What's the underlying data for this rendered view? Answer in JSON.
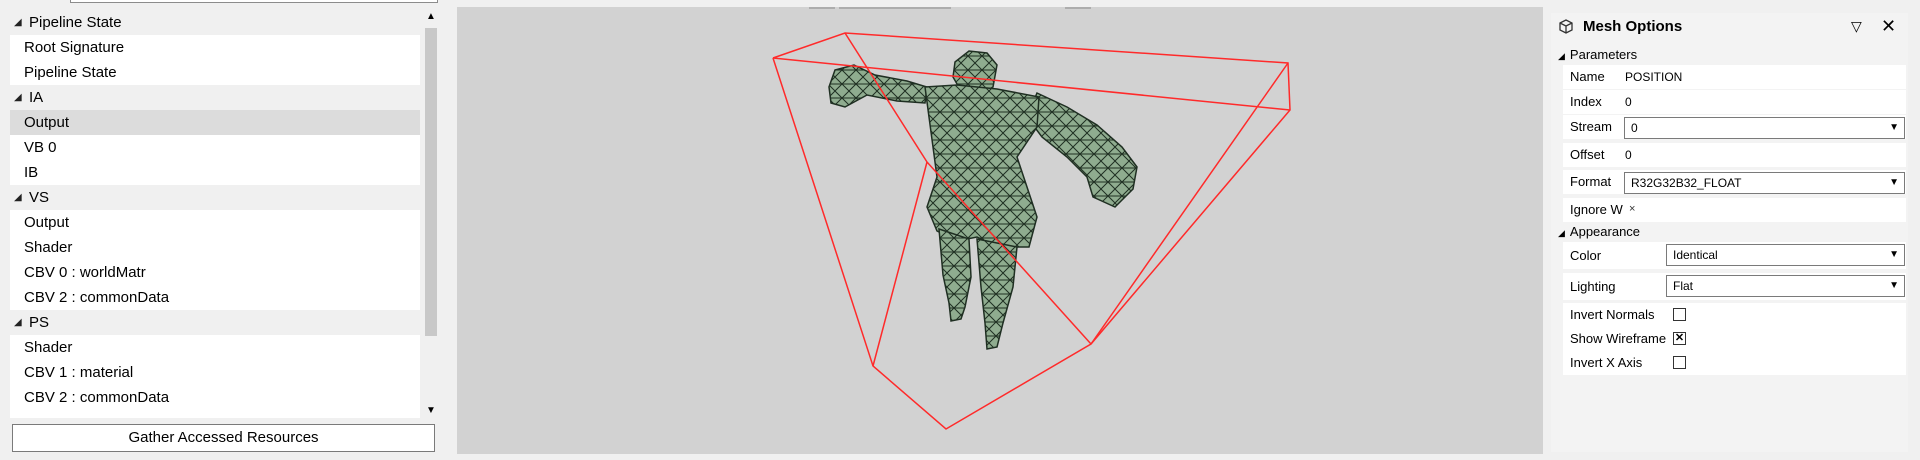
{
  "tree": {
    "groups": [
      {
        "label": "Pipeline State",
        "items": [
          "Root Signature",
          "Pipeline State"
        ]
      },
      {
        "label": "IA",
        "items": [
          "Output",
          "VB 0",
          "IB"
        ],
        "selected_index": 0
      },
      {
        "label": "VS",
        "items": [
          "Output",
          "Shader",
          "CBV 0 : worldMatr",
          "CBV 2 : commonData"
        ]
      },
      {
        "label": "PS",
        "items": [
          "Shader",
          "CBV 1 : material",
          "CBV 2 : commonData"
        ]
      }
    ],
    "gather_button": "Gather Accessed Resources"
  },
  "mesh_options": {
    "title": "Mesh Options",
    "sections": {
      "parameters": "Parameters",
      "appearance": "Appearance"
    },
    "parameters": {
      "name_label": "Name",
      "name_value": "POSITION",
      "index_label": "Index",
      "index_value": "0",
      "stream_label": "Stream",
      "stream_value": "0",
      "offset_label": "Offset",
      "offset_value": "0",
      "format_label": "Format",
      "format_value": "R32G32B32_FLOAT",
      "ignore_w_label": "Ignore W",
      "ignore_w_value": "×"
    },
    "appearance": {
      "color_label": "Color",
      "color_value": "Identical",
      "lighting_label": "Lighting",
      "lighting_value": "Flat",
      "invert_normals_label": "Invert Normals",
      "invert_normals_checked": false,
      "show_wireframe_label": "Show Wireframe",
      "show_wireframe_checked": true,
      "invert_x_label": "Invert X Axis",
      "invert_x_checked": false
    }
  },
  "colors": {
    "bounding_box": "#ff2a2a",
    "mesh_fill": "#8fac8f",
    "mesh_wire": "#1f2f22",
    "viewport_bg": "#d2d2d2"
  }
}
